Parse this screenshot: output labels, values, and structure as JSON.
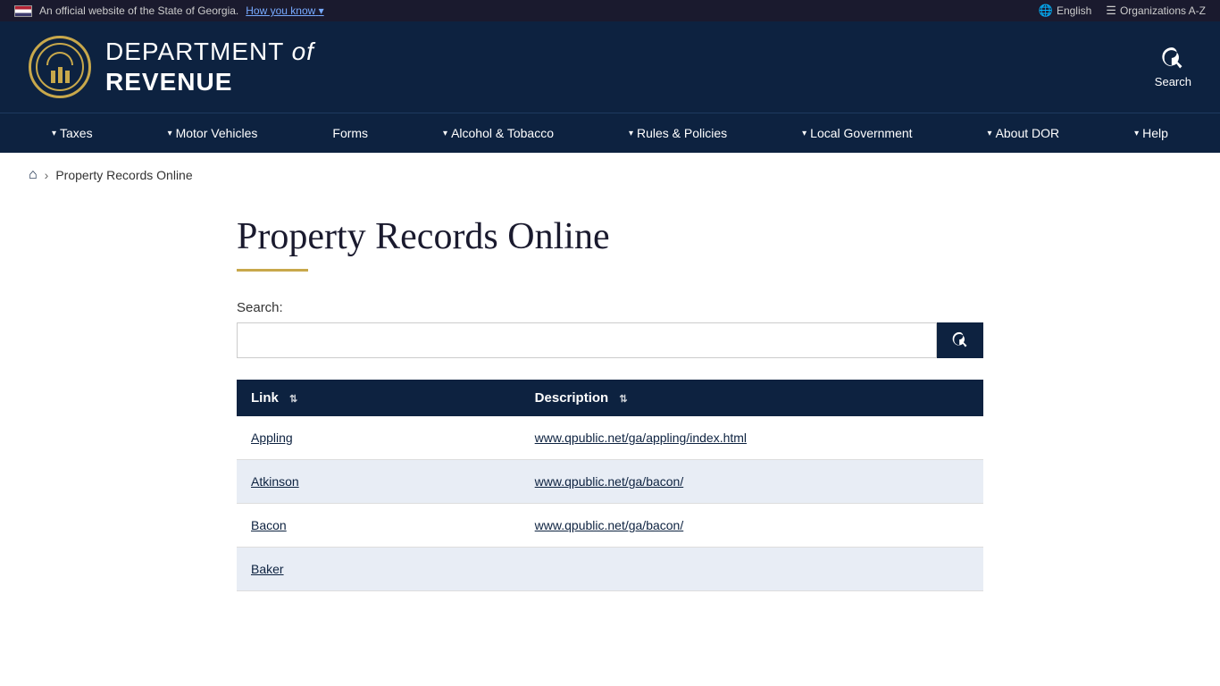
{
  "topbar": {
    "official_text": "An official website of the State of Georgia.",
    "how_you_know": "How you know",
    "chevron": "▾",
    "english_label": "English",
    "org_label": "Organizations A-Z"
  },
  "header": {
    "dept_line1": "DEPARTMENT",
    "dept_of": "of",
    "dept_line2": "REVENUE",
    "search_label": "Search"
  },
  "nav": {
    "items": [
      {
        "label": "Taxes",
        "has_dropdown": true
      },
      {
        "label": "Motor Vehicles",
        "has_dropdown": true
      },
      {
        "label": "Forms",
        "has_dropdown": false
      },
      {
        "label": "Alcohol & Tobacco",
        "has_dropdown": true
      },
      {
        "label": "Rules & Policies",
        "has_dropdown": true
      },
      {
        "label": "Local Government",
        "has_dropdown": true
      },
      {
        "label": "About DOR",
        "has_dropdown": true
      },
      {
        "label": "Help",
        "has_dropdown": true
      }
    ]
  },
  "breadcrumb": {
    "home_label": "Home",
    "current": "Property Records Online"
  },
  "page": {
    "title": "Property Records Online",
    "search_label": "Search:",
    "search_placeholder": "",
    "table": {
      "columns": [
        {
          "label": "Link"
        },
        {
          "label": "Description"
        }
      ],
      "rows": [
        {
          "link_text": "Appling",
          "link_url": "https://www.qpublic.net/ga/appling/index.html",
          "description": "www.qpublic.net/ga/appling/index.html"
        },
        {
          "link_text": "Atkinson",
          "link_url": "https://www.qpublic.net/ga/bacon/",
          "description": "www.qpublic.net/ga/bacon/"
        },
        {
          "link_text": "Bacon",
          "link_url": "https://www.qpublic.net/ga/bacon/",
          "description": "www.qpublic.net/ga/bacon/"
        },
        {
          "link_text": "Baker",
          "link_url": "",
          "description": ""
        }
      ]
    }
  }
}
